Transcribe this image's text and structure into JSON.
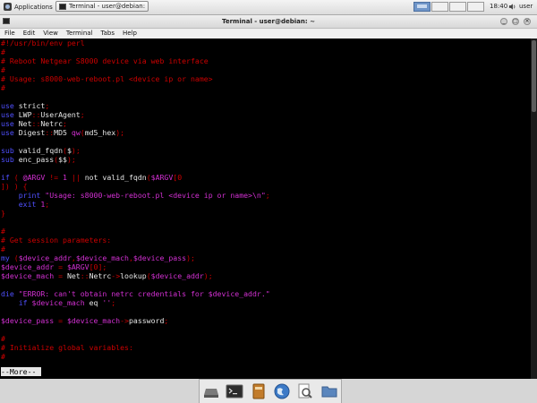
{
  "panel": {
    "applications_label": "Applications",
    "task_label": "Terminal - user@debian:",
    "clock": "18:40",
    "user": "user"
  },
  "window": {
    "title": "Terminal - user@debian: ~"
  },
  "menu": [
    "File",
    "Edit",
    "View",
    "Terminal",
    "Tabs",
    "Help"
  ],
  "terminal": {
    "lines": [
      [
        {
          "t": "#!/usr/bin/env perl",
          "c": "c"
        }
      ],
      [
        {
          "t": "#",
          "c": "c"
        }
      ],
      [
        {
          "t": "# Reboot Netgear S8000 device via web interface",
          "c": "c"
        }
      ],
      [
        {
          "t": "#",
          "c": "c"
        }
      ],
      [
        {
          "t": "# Usage: s8000-web-reboot.pl <device ip or name>",
          "c": "c"
        }
      ],
      [
        {
          "t": "#",
          "c": "c"
        }
      ],
      [],
      [
        {
          "t": "use",
          "c": "k"
        },
        {
          "t": " strict",
          "c": "w"
        },
        {
          "t": ";",
          "c": "c"
        }
      ],
      [
        {
          "t": "use",
          "c": "k"
        },
        {
          "t": " LWP",
          "c": "w"
        },
        {
          "t": "::",
          "c": "c"
        },
        {
          "t": "UserAgent",
          "c": "w"
        },
        {
          "t": ";",
          "c": "c"
        }
      ],
      [
        {
          "t": "use",
          "c": "k"
        },
        {
          "t": " Net",
          "c": "w"
        },
        {
          "t": "::",
          "c": "c"
        },
        {
          "t": "Netrc",
          "c": "w"
        },
        {
          "t": ";",
          "c": "c"
        }
      ],
      [
        {
          "t": "use",
          "c": "k"
        },
        {
          "t": " Digest",
          "c": "w"
        },
        {
          "t": "::",
          "c": "c"
        },
        {
          "t": "MD5 ",
          "c": "w"
        },
        {
          "t": "qw",
          "c": "m"
        },
        {
          "t": "(",
          "c": "c"
        },
        {
          "t": "md5_hex",
          "c": "w"
        },
        {
          "t": ");",
          "c": "c"
        }
      ],
      [],
      [
        {
          "t": "sub",
          "c": "k"
        },
        {
          "t": " valid_fqdn",
          "c": "w"
        },
        {
          "t": "(",
          "c": "c"
        },
        {
          "t": "$",
          "c": "w"
        },
        {
          "t": ");",
          "c": "c"
        }
      ],
      [
        {
          "t": "sub",
          "c": "k"
        },
        {
          "t": " enc_pass",
          "c": "w"
        },
        {
          "t": "(",
          "c": "c"
        },
        {
          "t": "$$",
          "c": "w"
        },
        {
          "t": ");",
          "c": "c"
        }
      ],
      [],
      [
        {
          "t": "if",
          "c": "k"
        },
        {
          "t": " ( ",
          "c": "c"
        },
        {
          "t": "@ARGV",
          "c": "m"
        },
        {
          "t": " != ",
          "c": "c"
        },
        {
          "t": "1",
          "c": "m"
        },
        {
          "t": " || ",
          "c": "c"
        },
        {
          "t": "not valid_fqdn",
          "c": "w"
        },
        {
          "t": "(",
          "c": "c"
        },
        {
          "t": "$ARGV",
          "c": "m"
        },
        {
          "t": "[0",
          "c": "c"
        }
      ],
      [
        {
          "t": "]) ) {",
          "c": "c"
        }
      ],
      [
        {
          "t": "    ",
          "c": "w"
        },
        {
          "t": "print",
          "c": "k"
        },
        {
          "t": " \"Usage: s8000-web-reboot.pl <device ip or name>\\n\"",
          "c": "m"
        },
        {
          "t": ";",
          "c": "c"
        }
      ],
      [
        {
          "t": "    ",
          "c": "w"
        },
        {
          "t": "exit",
          "c": "k"
        },
        {
          "t": " 1",
          "c": "m"
        },
        {
          "t": ";",
          "c": "c"
        }
      ],
      [
        {
          "t": "}",
          "c": "c"
        }
      ],
      [],
      [
        {
          "t": "#",
          "c": "c"
        }
      ],
      [
        {
          "t": "# Get session parameters:",
          "c": "c"
        }
      ],
      [
        {
          "t": "#",
          "c": "c"
        }
      ],
      [
        {
          "t": "my",
          "c": "k"
        },
        {
          "t": " (",
          "c": "c"
        },
        {
          "t": "$device_addr",
          "c": "m"
        },
        {
          "t": ",",
          "c": "c"
        },
        {
          "t": "$device_mach",
          "c": "m"
        },
        {
          "t": ",",
          "c": "c"
        },
        {
          "t": "$device_pass",
          "c": "m"
        },
        {
          "t": ");",
          "c": "c"
        }
      ],
      [
        {
          "t": "$device_addr",
          "c": "m"
        },
        {
          "t": " = ",
          "c": "c"
        },
        {
          "t": "$ARGV",
          "c": "m"
        },
        {
          "t": "[0];",
          "c": "c"
        }
      ],
      [
        {
          "t": "$device_mach",
          "c": "m"
        },
        {
          "t": " = ",
          "c": "c"
        },
        {
          "t": "Net",
          "c": "w"
        },
        {
          "t": "::",
          "c": "c"
        },
        {
          "t": "Netrc",
          "c": "w"
        },
        {
          "t": "->",
          "c": "c"
        },
        {
          "t": "lookup",
          "c": "w"
        },
        {
          "t": "(",
          "c": "c"
        },
        {
          "t": "$device_addr",
          "c": "m"
        },
        {
          "t": ");",
          "c": "c"
        }
      ],
      [],
      [
        {
          "t": "die",
          "c": "k"
        },
        {
          "t": " \"ERROR: can't obtain netrc credentials for $device_addr.\"",
          "c": "m"
        }
      ],
      [
        {
          "t": "    ",
          "c": "w"
        },
        {
          "t": "if",
          "c": "k"
        },
        {
          "t": " ",
          "c": "w"
        },
        {
          "t": "$device_mach",
          "c": "m"
        },
        {
          "t": " eq",
          "c": "w"
        },
        {
          "t": " ''",
          "c": "m"
        },
        {
          "t": ";",
          "c": "c"
        }
      ],
      [],
      [
        {
          "t": "$device_pass",
          "c": "m"
        },
        {
          "t": " = ",
          "c": "c"
        },
        {
          "t": "$device_mach",
          "c": "m"
        },
        {
          "t": "->",
          "c": "c"
        },
        {
          "t": "password",
          "c": "w"
        },
        {
          "t": ";",
          "c": "c"
        }
      ],
      [],
      [
        {
          "t": "#",
          "c": "c"
        }
      ],
      [
        {
          "t": "# Initialize global variables:",
          "c": "c"
        }
      ],
      [
        {
          "t": "#",
          "c": "c"
        }
      ]
    ],
    "pager_prompt": "--More--"
  },
  "dock": {
    "items": [
      "disk-icon",
      "terminal-icon",
      "file-manager-icon",
      "web-browser-icon",
      "search-icon",
      "folder-icon"
    ]
  },
  "colors": {
    "comment": "#cc0000",
    "keyword": "#5050ff",
    "string": "#d230d2",
    "text": "#e5e5e5",
    "background": "#000000"
  }
}
